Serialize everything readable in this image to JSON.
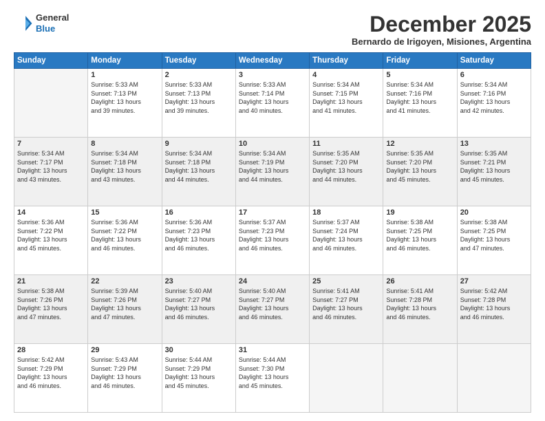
{
  "logo": {
    "line1": "General",
    "line2": "Blue"
  },
  "header": {
    "month": "December 2025",
    "location": "Bernardo de Irigoyen, Misiones, Argentina"
  },
  "weekdays": [
    "Sunday",
    "Monday",
    "Tuesday",
    "Wednesday",
    "Thursday",
    "Friday",
    "Saturday"
  ],
  "weeks": [
    [
      {
        "day": "",
        "info": ""
      },
      {
        "day": "1",
        "info": "Sunrise: 5:33 AM\nSunset: 7:13 PM\nDaylight: 13 hours\nand 39 minutes."
      },
      {
        "day": "2",
        "info": "Sunrise: 5:33 AM\nSunset: 7:13 PM\nDaylight: 13 hours\nand 39 minutes."
      },
      {
        "day": "3",
        "info": "Sunrise: 5:33 AM\nSunset: 7:14 PM\nDaylight: 13 hours\nand 40 minutes."
      },
      {
        "day": "4",
        "info": "Sunrise: 5:34 AM\nSunset: 7:15 PM\nDaylight: 13 hours\nand 41 minutes."
      },
      {
        "day": "5",
        "info": "Sunrise: 5:34 AM\nSunset: 7:16 PM\nDaylight: 13 hours\nand 41 minutes."
      },
      {
        "day": "6",
        "info": "Sunrise: 5:34 AM\nSunset: 7:16 PM\nDaylight: 13 hours\nand 42 minutes."
      }
    ],
    [
      {
        "day": "7",
        "info": "Sunrise: 5:34 AM\nSunset: 7:17 PM\nDaylight: 13 hours\nand 43 minutes."
      },
      {
        "day": "8",
        "info": "Sunrise: 5:34 AM\nSunset: 7:18 PM\nDaylight: 13 hours\nand 43 minutes."
      },
      {
        "day": "9",
        "info": "Sunrise: 5:34 AM\nSunset: 7:18 PM\nDaylight: 13 hours\nand 44 minutes."
      },
      {
        "day": "10",
        "info": "Sunrise: 5:34 AM\nSunset: 7:19 PM\nDaylight: 13 hours\nand 44 minutes."
      },
      {
        "day": "11",
        "info": "Sunrise: 5:35 AM\nSunset: 7:20 PM\nDaylight: 13 hours\nand 44 minutes."
      },
      {
        "day": "12",
        "info": "Sunrise: 5:35 AM\nSunset: 7:20 PM\nDaylight: 13 hours\nand 45 minutes."
      },
      {
        "day": "13",
        "info": "Sunrise: 5:35 AM\nSunset: 7:21 PM\nDaylight: 13 hours\nand 45 minutes."
      }
    ],
    [
      {
        "day": "14",
        "info": "Sunrise: 5:36 AM\nSunset: 7:22 PM\nDaylight: 13 hours\nand 45 minutes."
      },
      {
        "day": "15",
        "info": "Sunrise: 5:36 AM\nSunset: 7:22 PM\nDaylight: 13 hours\nand 46 minutes."
      },
      {
        "day": "16",
        "info": "Sunrise: 5:36 AM\nSunset: 7:23 PM\nDaylight: 13 hours\nand 46 minutes."
      },
      {
        "day": "17",
        "info": "Sunrise: 5:37 AM\nSunset: 7:23 PM\nDaylight: 13 hours\nand 46 minutes."
      },
      {
        "day": "18",
        "info": "Sunrise: 5:37 AM\nSunset: 7:24 PM\nDaylight: 13 hours\nand 46 minutes."
      },
      {
        "day": "19",
        "info": "Sunrise: 5:38 AM\nSunset: 7:25 PM\nDaylight: 13 hours\nand 46 minutes."
      },
      {
        "day": "20",
        "info": "Sunrise: 5:38 AM\nSunset: 7:25 PM\nDaylight: 13 hours\nand 47 minutes."
      }
    ],
    [
      {
        "day": "21",
        "info": "Sunrise: 5:38 AM\nSunset: 7:26 PM\nDaylight: 13 hours\nand 47 minutes."
      },
      {
        "day": "22",
        "info": "Sunrise: 5:39 AM\nSunset: 7:26 PM\nDaylight: 13 hours\nand 47 minutes."
      },
      {
        "day": "23",
        "info": "Sunrise: 5:40 AM\nSunset: 7:27 PM\nDaylight: 13 hours\nand 46 minutes."
      },
      {
        "day": "24",
        "info": "Sunrise: 5:40 AM\nSunset: 7:27 PM\nDaylight: 13 hours\nand 46 minutes."
      },
      {
        "day": "25",
        "info": "Sunrise: 5:41 AM\nSunset: 7:27 PM\nDaylight: 13 hours\nand 46 minutes."
      },
      {
        "day": "26",
        "info": "Sunrise: 5:41 AM\nSunset: 7:28 PM\nDaylight: 13 hours\nand 46 minutes."
      },
      {
        "day": "27",
        "info": "Sunrise: 5:42 AM\nSunset: 7:28 PM\nDaylight: 13 hours\nand 46 minutes."
      }
    ],
    [
      {
        "day": "28",
        "info": "Sunrise: 5:42 AM\nSunset: 7:29 PM\nDaylight: 13 hours\nand 46 minutes."
      },
      {
        "day": "29",
        "info": "Sunrise: 5:43 AM\nSunset: 7:29 PM\nDaylight: 13 hours\nand 46 minutes."
      },
      {
        "day": "30",
        "info": "Sunrise: 5:44 AM\nSunset: 7:29 PM\nDaylight: 13 hours\nand 45 minutes."
      },
      {
        "day": "31",
        "info": "Sunrise: 5:44 AM\nSunset: 7:30 PM\nDaylight: 13 hours\nand 45 minutes."
      },
      {
        "day": "",
        "info": ""
      },
      {
        "day": "",
        "info": ""
      },
      {
        "day": "",
        "info": ""
      }
    ]
  ]
}
